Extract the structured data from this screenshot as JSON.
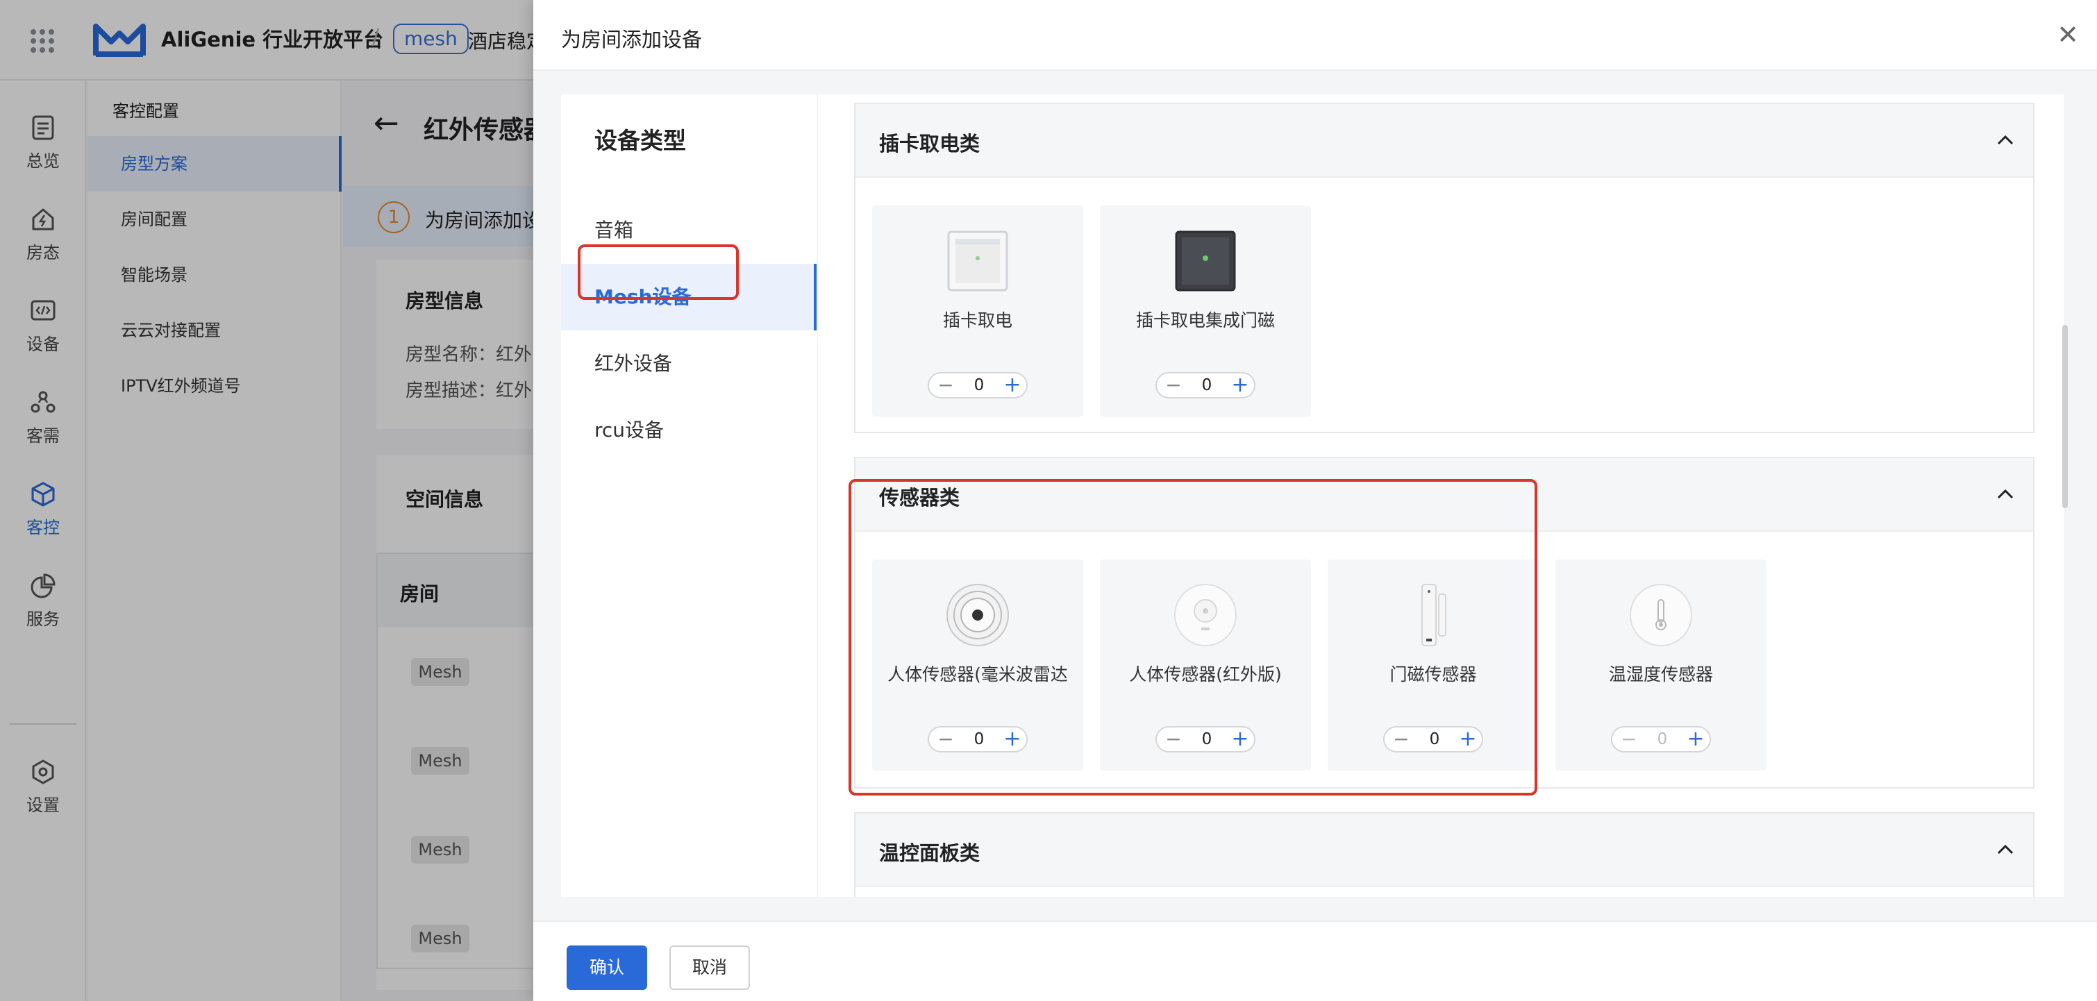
{
  "topbar": {
    "brand": "AliGenie 行业开放平台",
    "separator": "/",
    "project_tag": "mesh",
    "hotel_name": "酒店稳定"
  },
  "leftnav": {
    "items": [
      {
        "label": "总览",
        "icon": "document-icon"
      },
      {
        "label": "房态",
        "icon": "house-icon"
      },
      {
        "label": "设备",
        "icon": "device-code-icon"
      },
      {
        "label": "客需",
        "icon": "people-icon"
      },
      {
        "label": "客控",
        "icon": "cube-icon",
        "active": true
      },
      {
        "label": "服务",
        "icon": "pie-icon"
      },
      {
        "label": "设置",
        "icon": "hex-gear-icon"
      }
    ]
  },
  "subnav": {
    "title": "客控配置",
    "items": [
      {
        "label": "房型方案",
        "active": true
      },
      {
        "label": "房间配置"
      },
      {
        "label": "智能场景"
      },
      {
        "label": "云云对接配置"
      },
      {
        "label": "IPTV红外频道号"
      }
    ]
  },
  "bg_main": {
    "title": "红外传感器",
    "step_number": "1",
    "step_text": "为房间添加设",
    "room_type_card": {
      "title": "房型信息",
      "name_label": "房型名称：红外",
      "desc_label": "房型描述：红外"
    },
    "space_card": {
      "title": "空间信息"
    },
    "room_table": {
      "header": "房间",
      "rows": [
        "Mesh",
        "Mesh",
        "Mesh",
        "Mesh"
      ]
    }
  },
  "drawer": {
    "title": "为房间添加设备",
    "close_icon": "close-icon",
    "category_title": "设备类型",
    "categories": [
      {
        "label": "音箱"
      },
      {
        "label": "Mesh设备",
        "active": true
      },
      {
        "label": "红外设备"
      },
      {
        "label": "rcu设备"
      }
    ],
    "groups": [
      {
        "title": "插卡取电类",
        "devices": [
          {
            "name": "插卡取电",
            "count": "0",
            "icon": "card-power-switch-icon"
          },
          {
            "name": "插卡取电集成门磁",
            "count": "0",
            "icon": "card-power-door-icon"
          }
        ]
      },
      {
        "title": "传感器类",
        "devices": [
          {
            "name": "人体传感器(毫米波雷达",
            "count": "0",
            "icon": "radar-sensor-icon"
          },
          {
            "name": "人体传感器(红外版)",
            "count": "0",
            "icon": "infrared-sensor-icon"
          },
          {
            "name": "门磁传感器",
            "count": "0",
            "icon": "door-sensor-icon"
          },
          {
            "name": "温湿度传感器",
            "count": "0",
            "icon": "thermometer-icon",
            "disabled": true
          }
        ]
      },
      {
        "title": "温控面板类",
        "devices": []
      }
    ],
    "confirm_label": "确认",
    "cancel_label": "取消"
  },
  "colors": {
    "accent": "#2a6ad8",
    "annotation": "#d9362b",
    "step_badge": "#e58b2c"
  }
}
